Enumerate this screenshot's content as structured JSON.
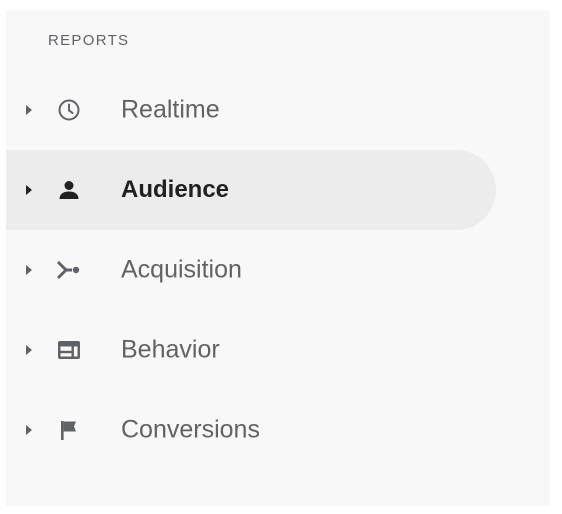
{
  "sidebar": {
    "heading": "REPORTS",
    "items": [
      {
        "label": "Realtime",
        "icon": "clock-icon",
        "active": false
      },
      {
        "label": "Audience",
        "icon": "person-icon",
        "active": true
      },
      {
        "label": "Acquisition",
        "icon": "acquisition-icon",
        "active": false
      },
      {
        "label": "Behavior",
        "icon": "behavior-icon",
        "active": false
      },
      {
        "label": "Conversions",
        "icon": "flag-icon",
        "active": false
      }
    ]
  },
  "colors": {
    "panel_background": "#f8f8f8",
    "active_background": "#ececec",
    "text_default": "#5f6368",
    "text_active": "#202124"
  }
}
